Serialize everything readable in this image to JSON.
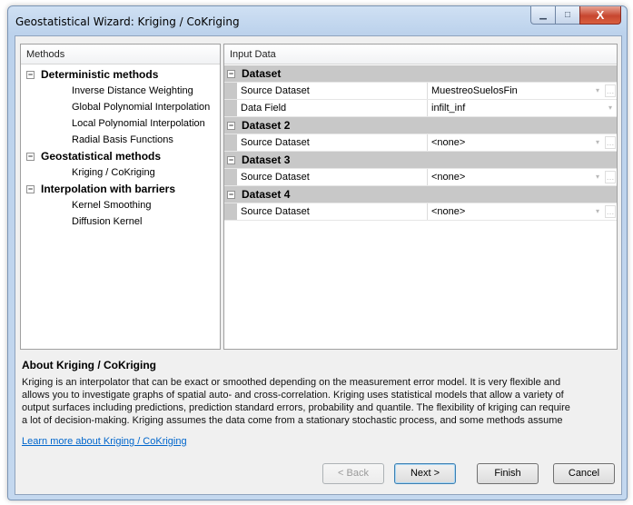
{
  "window": {
    "title": "Geostatistical Wizard: Kriging / CoKriging"
  },
  "methods_panel": {
    "header": "Methods",
    "groups": [
      {
        "label": "Deterministic methods",
        "toggle": "−",
        "children": [
          "Inverse Distance Weighting",
          "Global Polynomial Interpolation",
          "Local Polynomial Interpolation",
          "Radial Basis Functions"
        ]
      },
      {
        "label": "Geostatistical methods",
        "toggle": "−",
        "children": [
          "Kriging / CoKriging"
        ]
      },
      {
        "label": "Interpolation with barriers",
        "toggle": "−",
        "children": [
          "Kernel Smoothing",
          "Diffusion Kernel"
        ]
      }
    ]
  },
  "input_panel": {
    "header": "Input Data",
    "sections": [
      {
        "label": "Dataset",
        "toggle": "−",
        "rows": [
          {
            "name": "Source Dataset",
            "value": "MuestreoSuelosFin"
          },
          {
            "name": "Data Field",
            "value": "infilt_inf"
          }
        ]
      },
      {
        "label": "Dataset 2",
        "toggle": "−",
        "rows": [
          {
            "name": "Source Dataset",
            "value": "<none>"
          }
        ]
      },
      {
        "label": "Dataset 3",
        "toggle": "−",
        "rows": [
          {
            "name": "Source Dataset",
            "value": "<none>"
          }
        ]
      },
      {
        "label": "Dataset 4",
        "toggle": "−",
        "rows": [
          {
            "name": "Source Dataset",
            "value": "<none>"
          }
        ]
      }
    ]
  },
  "about": {
    "title": "About Kriging / CoKriging",
    "lines": [
      "Kriging is an interpolator that can be exact or smoothed depending on the measurement error model. It is very flexible and",
      "allows you to investigate graphs of spatial auto- and cross-correlation. Kriging uses statistical models that allow a variety of",
      "output surfaces including predictions, prediction standard errors, probability and quantile. The flexibility of kriging can require",
      "a lot of decision-making. Kriging assumes the data come from a stationary stochastic process, and some methods assume"
    ],
    "link": "Learn more about Kriging / CoKriging"
  },
  "buttons": {
    "back": "< Back",
    "next": "Next >",
    "finish": "Finish",
    "cancel": "Cancel"
  },
  "icons": {
    "minimize": "▁",
    "maximize": "□",
    "close": "X",
    "dropdown": "▾",
    "ellipsis": "…"
  }
}
